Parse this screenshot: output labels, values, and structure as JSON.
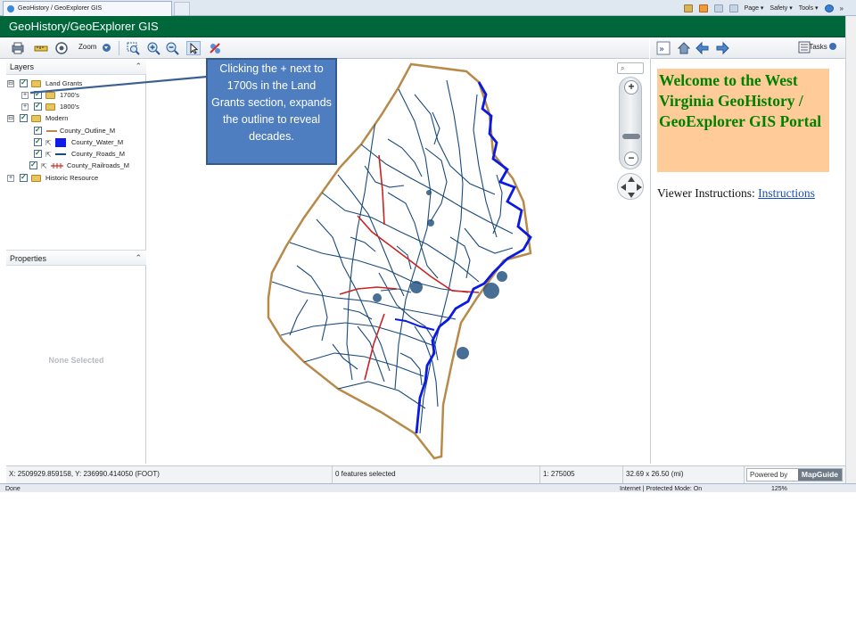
{
  "browser": {
    "tab_title": "GeoHistory / GeoExplorer GIS",
    "menu": [
      "Page ▾",
      "Safety ▾",
      "Tools ▾"
    ],
    "status_done": "Done",
    "zone_text": "Internet | Protected Mode: On",
    "zoom_level": "125%"
  },
  "app": {
    "title": "GeoHistory/GeoExplorer GIS"
  },
  "toolbar": {
    "zoom_label": "Zoom",
    "tasks_label": "Tasks"
  },
  "layers": {
    "title": "Layers",
    "items": [
      {
        "label": "Land Grants",
        "expander": "⊟",
        "level": 0,
        "symbol": "folder"
      },
      {
        "label": "1700's",
        "expander": "+",
        "level": 1,
        "symbol": "folder"
      },
      {
        "label": "1800's",
        "expander": "+",
        "level": 1,
        "symbol": "folder"
      },
      {
        "label": "Modern",
        "expander": "⊟",
        "level": 0,
        "symbol": "folder"
      },
      {
        "label": "County_Outline_M",
        "level": 1,
        "symbol": "line-tan"
      },
      {
        "label": "County_Water_M",
        "level": 1,
        "symbol": "box-blue"
      },
      {
        "label": "County_Roads_M",
        "level": 1,
        "symbol": "line-blue"
      },
      {
        "label": "County_Railroads_M",
        "level": 1,
        "symbol": "line-rail"
      },
      {
        "label": "Historic Resource",
        "expander": "+",
        "level": 0,
        "symbol": "folder"
      }
    ]
  },
  "properties": {
    "title": "Properties",
    "empty_text": "None Selected"
  },
  "callout": {
    "text": "Clicking the + next to 1700s in the Land Grants section, expands the outline to reveal decades."
  },
  "welcome": {
    "heading": "Welcome to the West Virginia GeoHistory / GeoExplorer GIS Portal",
    "instructions_label": "Viewer Instructions:",
    "instructions_link": "Instructions"
  },
  "status": {
    "coords": "X: 2509929.859158, Y: 236990.414050 (FOOT)",
    "features": "0 features selected",
    "scale": "1: 275005",
    "extent": "32.69 x 26.50 (mi)",
    "powered_by": "Powered by",
    "brand": "MapGuide"
  },
  "colors": {
    "title_bar": "#00673a",
    "callout": "#4f7ec0",
    "welcome_bg": "#ffcc99",
    "welcome_text": "#008000",
    "roads": "#1a4a7a",
    "water": "#0a1ae0",
    "railroad": "#cc2222",
    "county_outline": "#b88a4a"
  }
}
